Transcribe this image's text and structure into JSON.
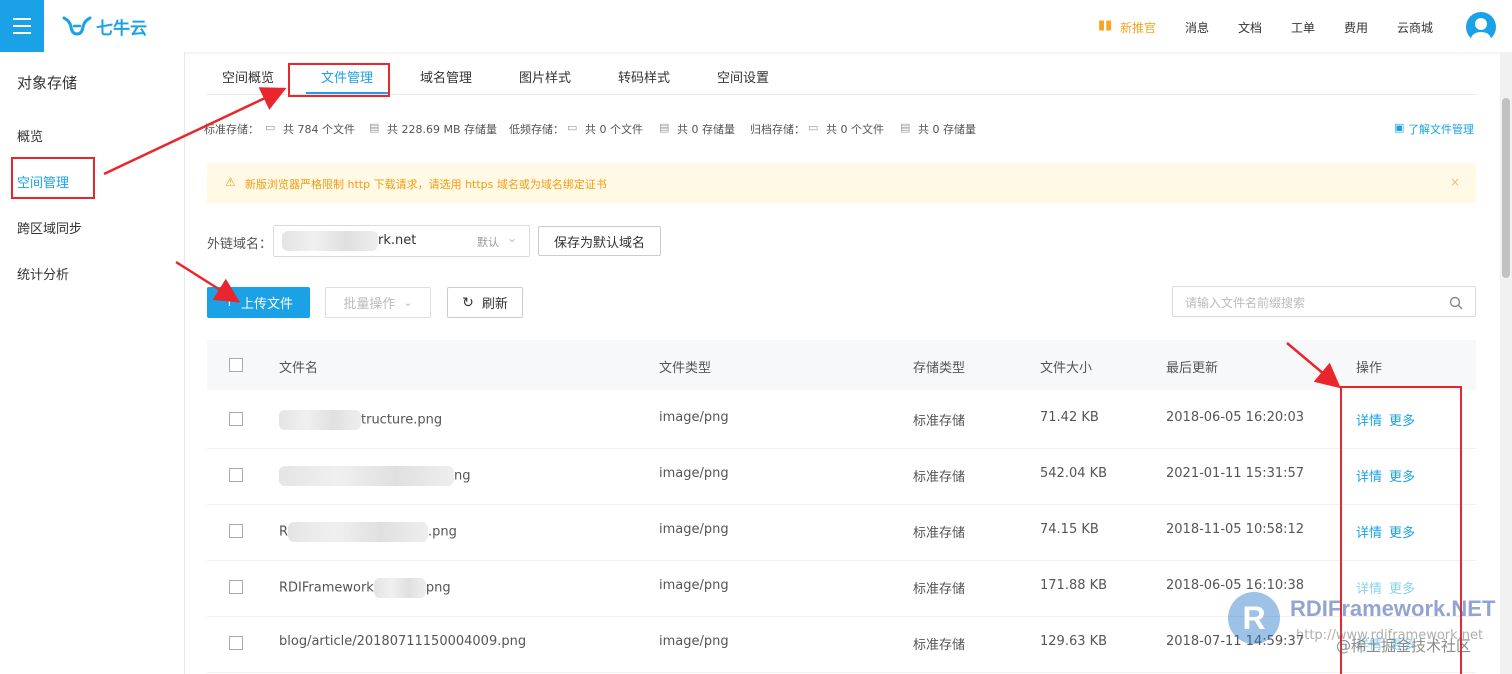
{
  "header": {
    "brand": "七牛云",
    "nav": [
      {
        "label": "新推官",
        "icon": "gift-icon"
      },
      {
        "label": "消息"
      },
      {
        "label": "文档"
      },
      {
        "label": "工单"
      },
      {
        "label": "费用"
      },
      {
        "label": "云商城"
      }
    ]
  },
  "sidebar": {
    "title": "对象存储",
    "items": [
      {
        "label": "概览"
      },
      {
        "label": "空间管理",
        "active": true
      },
      {
        "label": "跨区域同步"
      },
      {
        "label": "统计分析"
      }
    ]
  },
  "tabs": [
    {
      "label": "空间概览"
    },
    {
      "label": "文件管理",
      "active": true
    },
    {
      "label": "域名管理"
    },
    {
      "label": "图片样式"
    },
    {
      "label": "转码样式"
    },
    {
      "label": "空间设置"
    }
  ],
  "stats": {
    "standard": "标准存储：",
    "standard_files": "共 784 个文件",
    "standard_size": "共 228.69 MB 存储量",
    "low": "低频存储：",
    "low_files": "共 0 个文件",
    "low_size": "共 0 存储量",
    "archive": "归档存储：",
    "archive_files": "共 0 个文件",
    "archive_size": "共 0 存储量",
    "learn_link": "了解文件管理"
  },
  "alert": {
    "text": "新版浏览器严格限制 http 下载请求，请选用 https 域名或为域名绑定证书",
    "close": "×"
  },
  "domain": {
    "label": "外链域名：",
    "value": "rk.net",
    "default_tag": "默认",
    "save_button": "保存为默认域名"
  },
  "toolbar": {
    "upload": "上传文件",
    "batch": "批量操作",
    "refresh": "刷新",
    "search_placeholder": "请输入文件名前缀搜索"
  },
  "table": {
    "columns": [
      "文件名",
      "文件类型",
      "存储类型",
      "文件大小",
      "最后更新",
      "操作"
    ],
    "rows": [
      {
        "name": "tructure.png",
        "type": "image/png",
        "storage": "标准存储",
        "size": "71.42 KB",
        "updated": "2018-06-05 16:20:03",
        "detail": "详情",
        "more": "更多"
      },
      {
        "name": "ng",
        "type": "image/png",
        "storage": "标准存储",
        "size": "542.04 KB",
        "updated": "2021-01-11 15:31:57",
        "detail": "详情",
        "more": "更多"
      },
      {
        "name": "R",
        "name_suffix": ".png",
        "type": "image/png",
        "storage": "标准存储",
        "size": "74.15 KB",
        "updated": "2018-11-05 10:58:12",
        "detail": "详情",
        "more": "更多"
      },
      {
        "name": "RDIFramework",
        "name_suffix": "png",
        "type": "image/png",
        "storage": "标准存储",
        "size": "171.88 KB",
        "updated": "2018-06-05 16:10:38",
        "detail": "详情",
        "more": "更多"
      },
      {
        "name": "blog/article/20180711150004009.png",
        "type": "image/png",
        "storage": "标准存储",
        "size": "129.63 KB",
        "updated": "2018-07-11 14:59:37",
        "detail": "详情",
        "more": "更多"
      }
    ]
  },
  "watermark": {
    "logo_letter": "R",
    "title": "RDIFramework.NET",
    "url": "http://www.rdiframework.net",
    "community": "@稀土掘金技术社区"
  },
  "colors": {
    "accent": "#1aa1e6",
    "annotation": "#e8262b",
    "alert_text": "#f39c12"
  }
}
